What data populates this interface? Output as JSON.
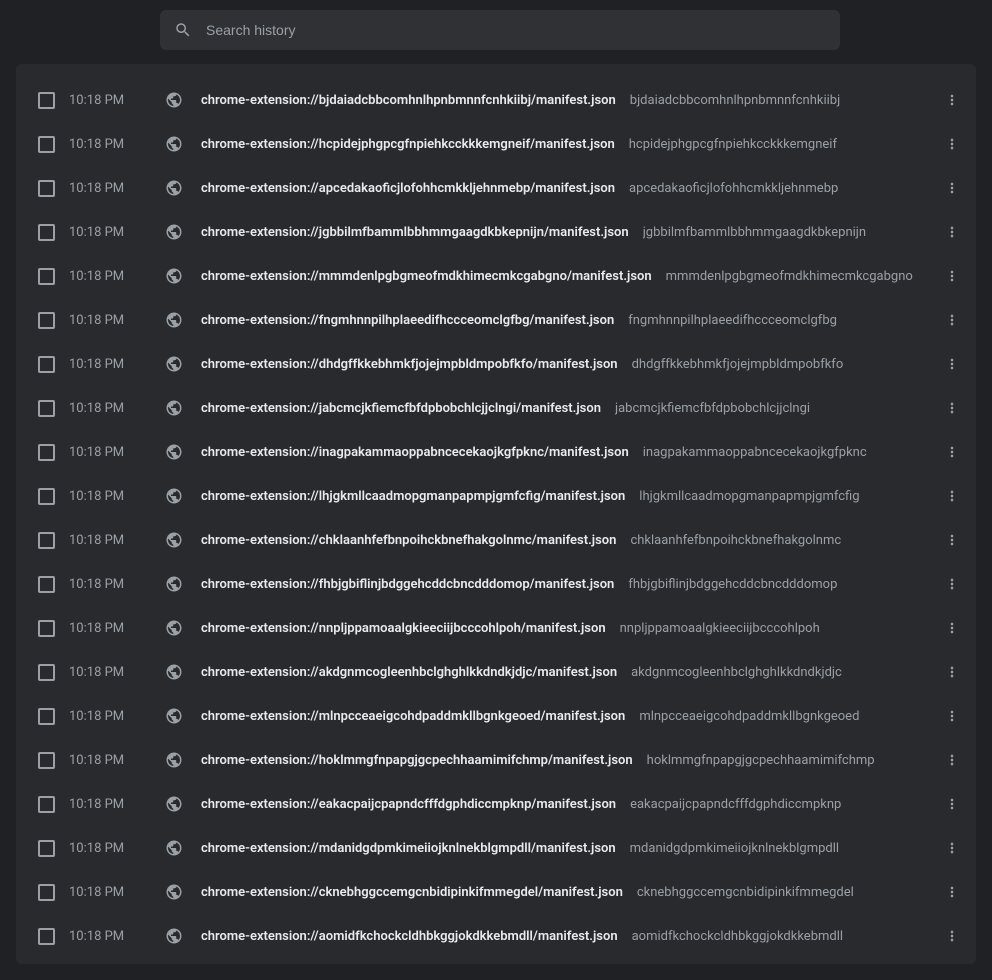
{
  "search": {
    "placeholder": "Search history"
  },
  "entries": [
    {
      "time": "10:18 PM",
      "title": "chrome-extension://bjdaiadcbbcomhnlhpnbmnnfcnhkiibj/manifest.json",
      "domain": "bjdaiadcbbcomhnlhpnbmnnfcnhkiibj"
    },
    {
      "time": "10:18 PM",
      "title": "chrome-extension://hcpidejphgpcgfnpiehkcckkkemgneif/manifest.json",
      "domain": "hcpidejphgpcgfnpiehkcckkkemgneif"
    },
    {
      "time": "10:18 PM",
      "title": "chrome-extension://apcedakaoficjlofohhcmkkljehnmebp/manifest.json",
      "domain": "apcedakaoficjlofohhcmkkljehnmebp"
    },
    {
      "time": "10:18 PM",
      "title": "chrome-extension://jgbbilmfbammlbbhmmgaagdkbkepnijn/manifest.json",
      "domain": "jgbbilmfbammlbbhmmgaagdkbkepnijn"
    },
    {
      "time": "10:18 PM",
      "title": "chrome-extension://mmmdenlpgbgmeofmdkhimecmkcgabgno/manifest.json",
      "domain": "mmmdenlpgbgmeofmdkhimecmkcgabgno"
    },
    {
      "time": "10:18 PM",
      "title": "chrome-extension://fngmhnnpilhplaeedifhccceomclgfbg/manifest.json",
      "domain": "fngmhnnpilhplaeedifhccceomclgfbg"
    },
    {
      "time": "10:18 PM",
      "title": "chrome-extension://dhdgffkkebhmkfjojejmpbldmpobfkfo/manifest.json",
      "domain": "dhdgffkkebhmkfjojejmpbldmpobfkfo"
    },
    {
      "time": "10:18 PM",
      "title": "chrome-extension://jabcmcjkfiemcfbfdpbobchlcjjclngi/manifest.json",
      "domain": "jabcmcjkfiemcfbfdpbobchlcjjclngi"
    },
    {
      "time": "10:18 PM",
      "title": "chrome-extension://inagpakammaoppabncecekaojkgfpknc/manifest.json",
      "domain": "inagpakammaoppabncecekaojkgfpknc"
    },
    {
      "time": "10:18 PM",
      "title": "chrome-extension://lhjgkmllcaadmopgmanpapmpjgmfcfig/manifest.json",
      "domain": "lhjgkmllcaadmopgmanpapmpjgmfcfig"
    },
    {
      "time": "10:18 PM",
      "title": "chrome-extension://chklaanhfefbnpoihckbnefhakgolnmc/manifest.json",
      "domain": "chklaanhfefbnpoihckbnefhakgolnmc"
    },
    {
      "time": "10:18 PM",
      "title": "chrome-extension://fhbjgbiflinjbdggehcddcbncdddomop/manifest.json",
      "domain": "fhbjgbiflinjbdggehcddcbncdddomop"
    },
    {
      "time": "10:18 PM",
      "title": "chrome-extension://nnpljppamoaalgkieeciijbcccohlpoh/manifest.json",
      "domain": "nnpljppamoaalgkieeciijbcccohlpoh"
    },
    {
      "time": "10:18 PM",
      "title": "chrome-extension://akdgnmcogleenhbclghghlkkdndkjdjc/manifest.json",
      "domain": "akdgnmcogleenhbclghghlkkdndkjdjc"
    },
    {
      "time": "10:18 PM",
      "title": "chrome-extension://mlnpcceaeigcohdpaddmkllbgnkgeoed/manifest.json",
      "domain": "mlnpcceaeigcohdpaddmkllbgnkgeoed"
    },
    {
      "time": "10:18 PM",
      "title": "chrome-extension://hoklmmgfnpapgjgcpechhaamimifchmp/manifest.json",
      "domain": "hoklmmgfnpapgjgcpechhaamimifchmp"
    },
    {
      "time": "10:18 PM",
      "title": "chrome-extension://eakacpaijcpapndcfffdgphdiccmpknp/manifest.json",
      "domain": "eakacpaijcpapndcfffdgphdiccmpknp"
    },
    {
      "time": "10:18 PM",
      "title": "chrome-extension://mdanidgdpmkimeiiojknlnekblgmpdll/manifest.json",
      "domain": "mdanidgdpmkimeiiojknlnekblgmpdll"
    },
    {
      "time": "10:18 PM",
      "title": "chrome-extension://cknebhggccemgcnbidipinkifmmegdel/manifest.json",
      "domain": "cknebhggccemgcnbidipinkifmmegdel"
    },
    {
      "time": "10:18 PM",
      "title": "chrome-extension://aomidfkchockcldhbkggjokdkkebmdll/manifest.json",
      "domain": "aomidfkchockcldhbkggjokdkkebmdll"
    }
  ]
}
